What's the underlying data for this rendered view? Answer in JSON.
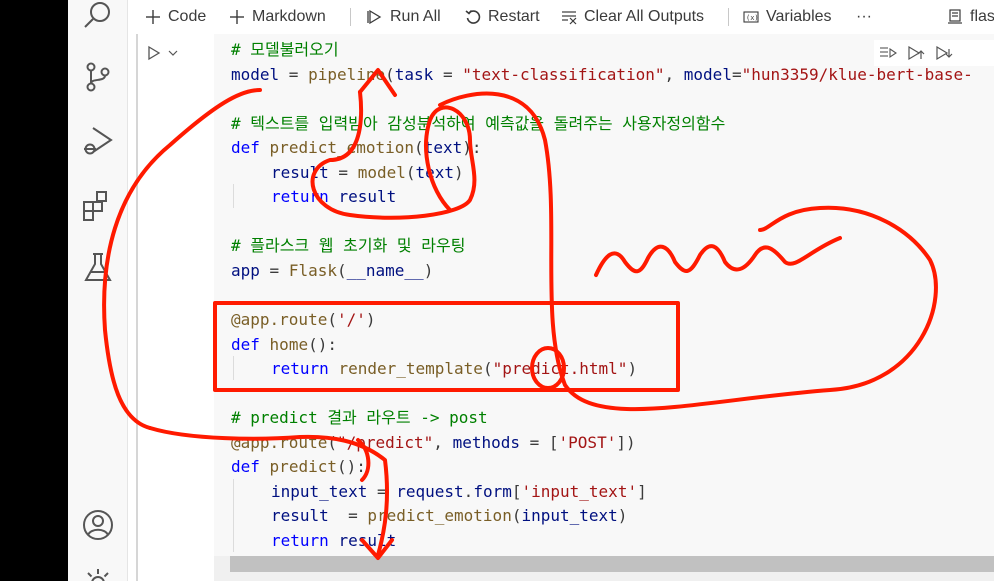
{
  "toolbar": {
    "code_label": "Code",
    "markdown_label": "Markdown",
    "run_all_label": "Run All",
    "restart_label": "Restart",
    "clear_outputs_label": "Clear All Outputs",
    "variables_label": "Variables",
    "more_label": "···",
    "kernel_label": "flas"
  },
  "activity_bar": {
    "icons": [
      "search-icon",
      "source-control-icon",
      "run-debug-icon",
      "extensions-icon",
      "testing-icon",
      "account-icon",
      "settings-icon"
    ]
  },
  "cell": {
    "lines": [
      {
        "indent": 0,
        "tokens": [
          {
            "t": "# 모델불러오기",
            "c": "c"
          }
        ]
      },
      {
        "indent": 0,
        "tokens": [
          {
            "t": "model",
            "c": "v"
          },
          {
            "t": " = ",
            "c": "p"
          },
          {
            "t": "pipeline",
            "c": "f"
          },
          {
            "t": "(",
            "c": "p"
          },
          {
            "t": "task",
            "c": "v"
          },
          {
            "t": " = ",
            "c": "p"
          },
          {
            "t": "\"text-classification\"",
            "c": "s"
          },
          {
            "t": ", ",
            "c": "p"
          },
          {
            "t": "model",
            "c": "v"
          },
          {
            "t": "=",
            "c": "p"
          },
          {
            "t": "\"hun3359/klue-bert-base-",
            "c": "s"
          }
        ]
      },
      {
        "indent": 0,
        "tokens": []
      },
      {
        "indent": 0,
        "tokens": [
          {
            "t": "# 텍스트를 입력받아 감성분석하여 예측값을 돌려주는 사용자정의함수",
            "c": "c"
          }
        ]
      },
      {
        "indent": 0,
        "tokens": [
          {
            "t": "def",
            "c": "k"
          },
          {
            "t": " ",
            "c": "p"
          },
          {
            "t": "predict_emotion",
            "c": "f"
          },
          {
            "t": "(",
            "c": "p"
          },
          {
            "t": "text",
            "c": "v"
          },
          {
            "t": "):",
            "c": "p"
          }
        ]
      },
      {
        "indent": 1,
        "tokens": [
          {
            "t": "result",
            "c": "v"
          },
          {
            "t": " = ",
            "c": "p"
          },
          {
            "t": "model",
            "c": "f"
          },
          {
            "t": "(",
            "c": "p"
          },
          {
            "t": "text",
            "c": "v"
          },
          {
            "t": ")",
            "c": "p"
          }
        ]
      },
      {
        "indent": 1,
        "tokens": [
          {
            "t": "return",
            "c": "k"
          },
          {
            "t": " ",
            "c": "p"
          },
          {
            "t": "result",
            "c": "v"
          }
        ]
      },
      {
        "indent": 0,
        "tokens": []
      },
      {
        "indent": 0,
        "tokens": [
          {
            "t": "# 플라스크 웹 초기화 및 라우팅",
            "c": "c"
          }
        ]
      },
      {
        "indent": 0,
        "tokens": [
          {
            "t": "app",
            "c": "v"
          },
          {
            "t": " = ",
            "c": "p"
          },
          {
            "t": "Flask",
            "c": "f"
          },
          {
            "t": "(",
            "c": "p"
          },
          {
            "t": "__name__",
            "c": "v"
          },
          {
            "t": ")",
            "c": "p"
          }
        ]
      },
      {
        "indent": 0,
        "tokens": []
      },
      {
        "indent": 0,
        "tokens": [
          {
            "t": "@app.route",
            "c": "d"
          },
          {
            "t": "(",
            "c": "p"
          },
          {
            "t": "'/'",
            "c": "s"
          },
          {
            "t": ")",
            "c": "p"
          }
        ]
      },
      {
        "indent": 0,
        "tokens": [
          {
            "t": "def",
            "c": "k"
          },
          {
            "t": " ",
            "c": "p"
          },
          {
            "t": "home",
            "c": "f"
          },
          {
            "t": "():",
            "c": "p"
          }
        ]
      },
      {
        "indent": 1,
        "tokens": [
          {
            "t": "return",
            "c": "k"
          },
          {
            "t": " ",
            "c": "p"
          },
          {
            "t": "render_template",
            "c": "f"
          },
          {
            "t": "(",
            "c": "p"
          },
          {
            "t": "\"predict.html\"",
            "c": "s"
          },
          {
            "t": ")",
            "c": "p"
          }
        ]
      },
      {
        "indent": 0,
        "tokens": []
      },
      {
        "indent": 0,
        "tokens": [
          {
            "t": "# predict 결과 라우트 -> post",
            "c": "c"
          }
        ]
      },
      {
        "indent": 0,
        "tokens": [
          {
            "t": "@app.route",
            "c": "d"
          },
          {
            "t": "(",
            "c": "p"
          },
          {
            "t": "\"/predict\"",
            "c": "s"
          },
          {
            "t": ", ",
            "c": "p"
          },
          {
            "t": "methods",
            "c": "v"
          },
          {
            "t": " = [",
            "c": "p"
          },
          {
            "t": "'POST'",
            "c": "s"
          },
          {
            "t": "])",
            "c": "p"
          }
        ]
      },
      {
        "indent": 0,
        "tokens": [
          {
            "t": "def",
            "c": "k"
          },
          {
            "t": " ",
            "c": "p"
          },
          {
            "t": "predict",
            "c": "f"
          },
          {
            "t": "():",
            "c": "p"
          }
        ]
      },
      {
        "indent": 1,
        "tokens": [
          {
            "t": "input_text",
            "c": "v"
          },
          {
            "t": " = ",
            "c": "p"
          },
          {
            "t": "request",
            "c": "v"
          },
          {
            "t": ".",
            "c": "p"
          },
          {
            "t": "form",
            "c": "v"
          },
          {
            "t": "[",
            "c": "p"
          },
          {
            "t": "'input_text'",
            "c": "s"
          },
          {
            "t": "]",
            "c": "p"
          }
        ]
      },
      {
        "indent": 1,
        "tokens": [
          {
            "t": "result",
            "c": "v"
          },
          {
            "t": "  = ",
            "c": "p"
          },
          {
            "t": "predict_emotion",
            "c": "f"
          },
          {
            "t": "(",
            "c": "p"
          },
          {
            "t": "input_text",
            "c": "v"
          },
          {
            "t": ")",
            "c": "p"
          }
        ]
      },
      {
        "indent": 1,
        "tokens": [
          {
            "t": "return",
            "c": "k"
          },
          {
            "t": " ",
            "c": "p"
          },
          {
            "t": "result",
            "c": "v"
          }
        ]
      }
    ]
  },
  "colors": {
    "annotation": "#ff1a00",
    "comment": "#008000",
    "keyword": "#0000ff",
    "function": "#795e26",
    "string": "#a31515",
    "variable": "#001080"
  }
}
